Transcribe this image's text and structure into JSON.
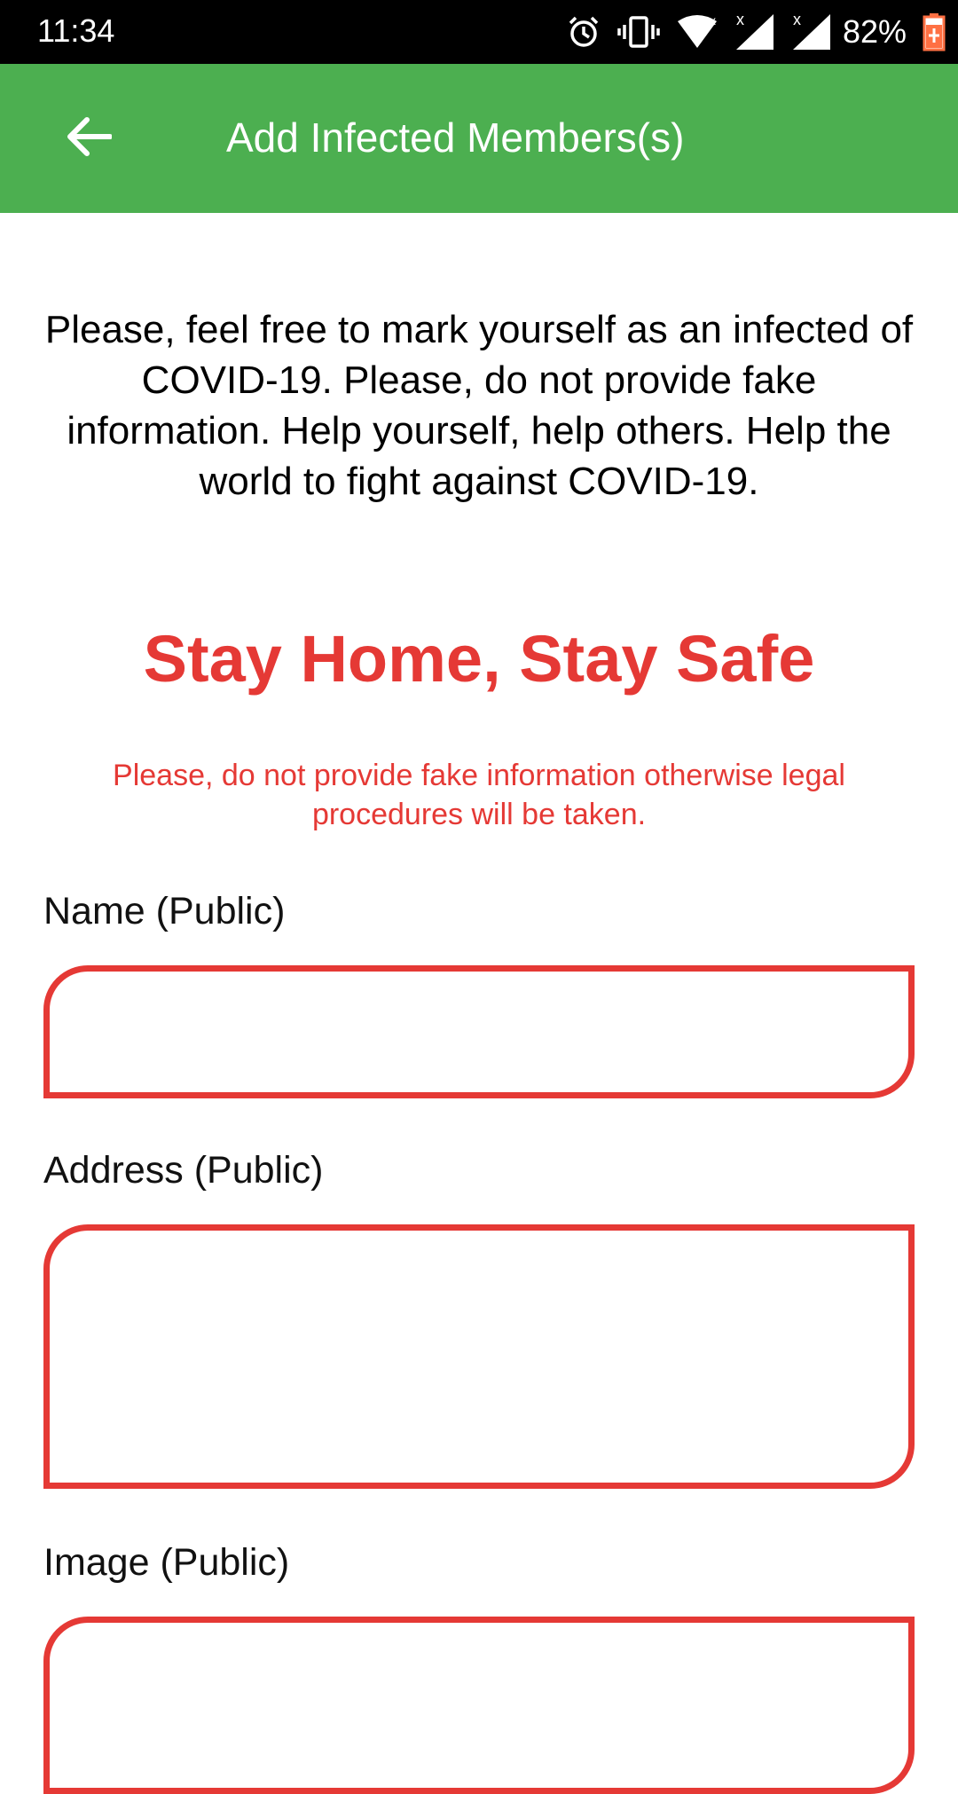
{
  "status_bar": {
    "time": "11:34",
    "battery_percent": "82%",
    "icons": [
      "alarm-icon",
      "vibrate-icon",
      "wifi-icon",
      "signal-icon",
      "signal-icon",
      "battery-charging-icon"
    ]
  },
  "app_bar": {
    "title": "Add Infected Members(s)",
    "back_icon": "arrow-back-icon",
    "color": "#4caf50"
  },
  "intro_text": "Please, feel free to mark yourself as an infected of COVID-19. Please, do not provide fake information. Help yourself, help others. Help the world to fight against COVID-19.",
  "slogan": "Stay Home, Stay Safe",
  "warning_text": "Please, do not provide fake information otherwise legal procedures will be taken.",
  "accent_color": "#e53935",
  "form": {
    "name_label": "Name (Public)",
    "name_value": "",
    "address_label": "Address (Public)",
    "address_value": "",
    "image_label": "Image (Public)"
  }
}
